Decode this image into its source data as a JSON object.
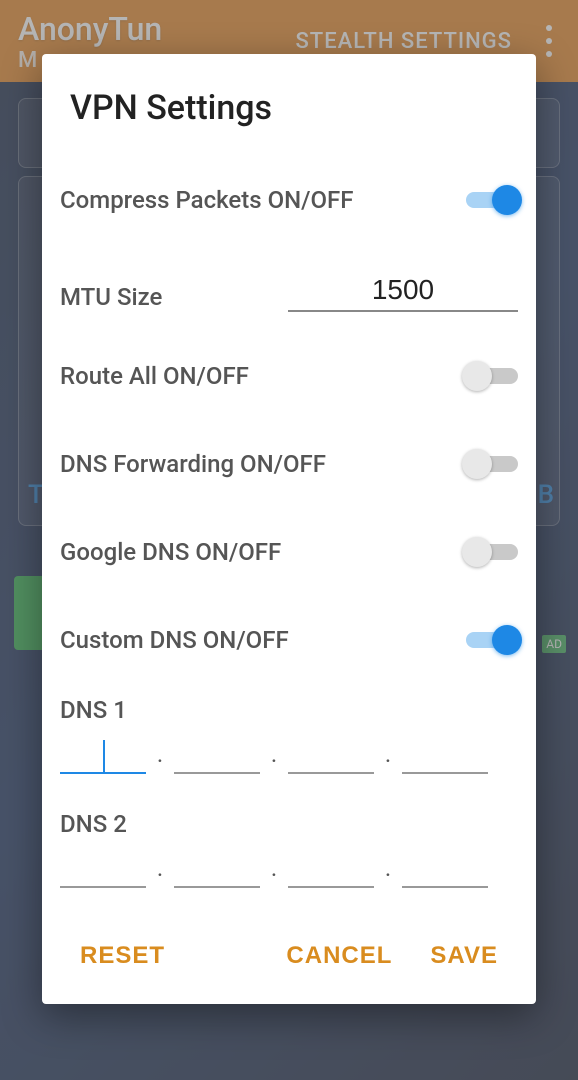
{
  "app": {
    "title": "AnonyTun",
    "subtitle": "M",
    "stealth_label": "STEALTH SETTINGS"
  },
  "dialog": {
    "title": "VPN Settings",
    "compress_label": "Compress Packets ON/OFF",
    "compress_on": true,
    "mtu_label": "MTU Size",
    "mtu_value": "1500",
    "route_label": "Route All ON/OFF",
    "route_on": false,
    "dnsfwd_label": "DNS Forwarding ON/OFF",
    "dnsfwd_on": false,
    "gdns_label": "Google DNS ON/OFF",
    "gdns_on": false,
    "cdns_label": "Custom DNS ON/OFF",
    "cdns_on": true,
    "dns1_label": "DNS 1",
    "dns1": [
      "",
      "",
      "",
      ""
    ],
    "dns2_label": "DNS 2",
    "dns2": [
      "",
      "",
      "",
      ""
    ]
  },
  "actions": {
    "reset": "RESET",
    "cancel": "CANCEL",
    "save": "SAVE"
  },
  "bg": {
    "t": "T",
    "b": "B",
    "ad": "AD"
  },
  "dot": "."
}
